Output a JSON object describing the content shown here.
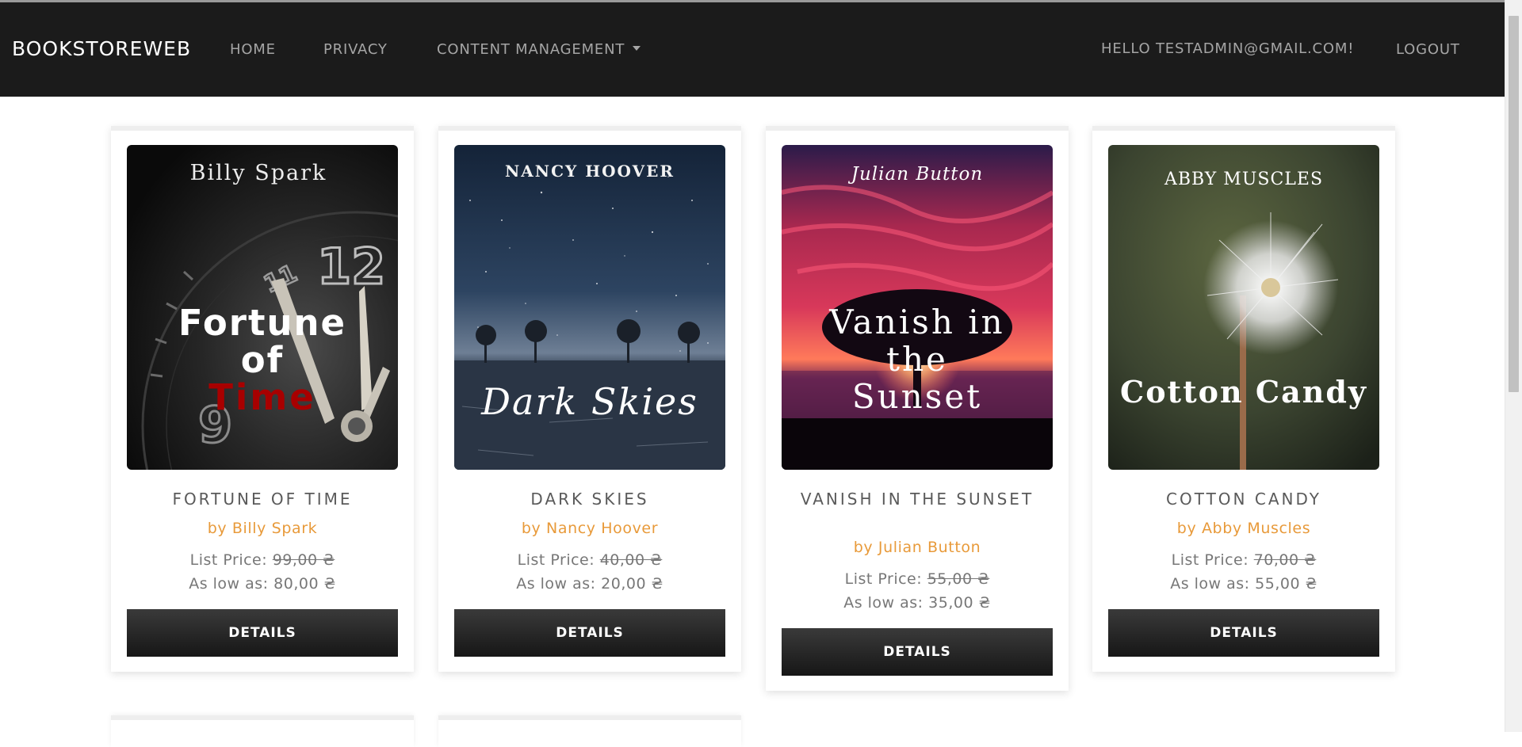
{
  "navbar": {
    "brand": "BOOKSTOREWEB",
    "links": {
      "home": "HOME",
      "privacy": "PRIVACY",
      "content_management": "CONTENT MANAGEMENT"
    },
    "greeting": "HELLO TESTADMIN@GMAIL.COM!",
    "logout": "LOGOUT"
  },
  "books": [
    {
      "title": "FORTUNE OF TIME",
      "author_prefix": "by",
      "author": "Billy Spark",
      "list_price_label": "List Price:",
      "list_price": "99,00 ₴",
      "low_label": "As low as:",
      "low_price": "80,00 ₴",
      "button": "DETAILS",
      "cover": {
        "author_text": "Billy Spark",
        "title_line1": "Fortune",
        "title_line2": "of",
        "title_line3": "Time",
        "clock_12": "12",
        "clock_9": "9",
        "clock_11": "11"
      }
    },
    {
      "title": "DARK SKIES",
      "author_prefix": "by",
      "author": "Nancy Hoover",
      "list_price_label": "List Price:",
      "list_price": "40,00 ₴",
      "low_label": "As low as:",
      "low_price": "20,00 ₴",
      "button": "DETAILS",
      "cover": {
        "author_text": "NANCY HOOVER",
        "title": "Dark Skies"
      }
    },
    {
      "title": "VANISH IN THE SUNSET",
      "author_prefix": "by",
      "author": "Julian Button",
      "list_price_label": "List Price:",
      "list_price": "55,00 ₴",
      "low_label": "As low as:",
      "low_price": "35,00 ₴",
      "button": "DETAILS",
      "cover": {
        "author_text": "Julian Button",
        "title_line1": "Vanish in",
        "title_line2": "the",
        "title_line3": "Sunset"
      }
    },
    {
      "title": "COTTON CANDY",
      "author_prefix": "by",
      "author": "Abby Muscles",
      "list_price_label": "List Price:",
      "list_price": "70,00 ₴",
      "low_label": "As low as:",
      "low_price": "55,00 ₴",
      "button": "DETAILS",
      "cover": {
        "author_text": "ABBY MUSCLES",
        "title": "Cotton Candy"
      }
    }
  ],
  "colors": {
    "navbar_bg": "#1b1b1b",
    "author_accent": "#e89a3a",
    "button_bg": "#1f1f1f"
  }
}
